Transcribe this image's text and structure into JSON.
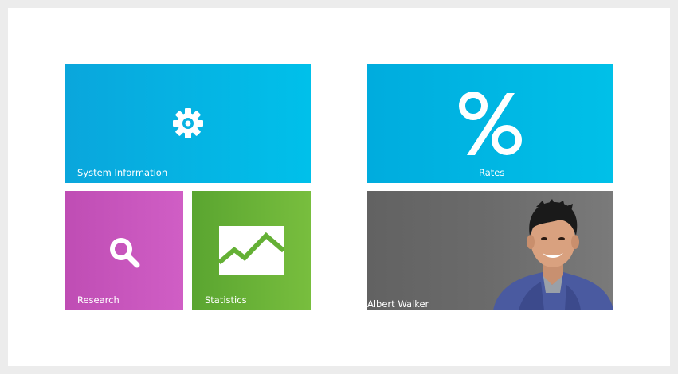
{
  "tiles": {
    "system_information": {
      "label": "System Information",
      "icon": "gear-icon",
      "color": "#0aa6dc"
    },
    "rates": {
      "label": "Rates",
      "icon": "percent-icon",
      "color": "#00b4e4"
    },
    "research": {
      "label": "Research",
      "icon": "search-icon",
      "color": "#c653bc"
    },
    "statistics": {
      "label": "Statistics",
      "icon": "line-chart-icon",
      "color": "#66ad35"
    },
    "user": {
      "label": "Albert Walker",
      "icon": "user-photo",
      "color": "#6b6b6b"
    }
  }
}
